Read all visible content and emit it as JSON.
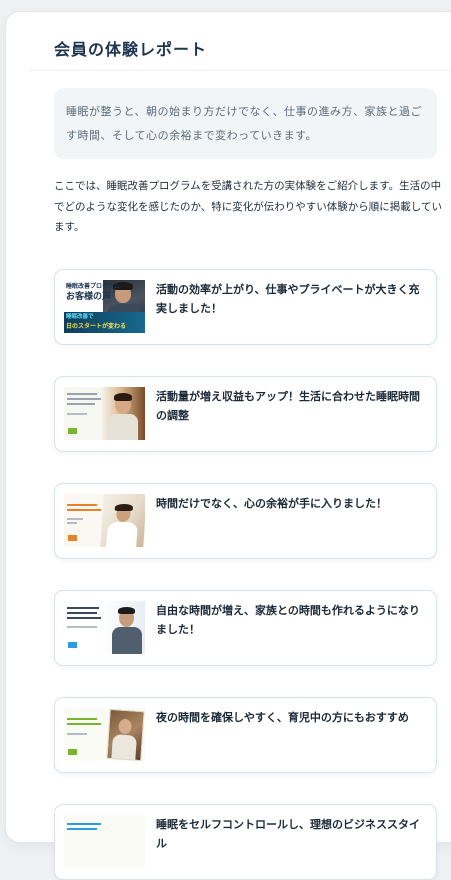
{
  "section": {
    "title": "会員の体験レポート",
    "lead": "睡眠が整うと、朝の始まり方だけでなく、仕事の進み方、家族と過ごす時間、そして心の余裕まで変わっていきます。",
    "intro": "ここでは、睡眠改善プログラムを受講された方の実体験をご紹介します。生活の中でどのような変化を感じたのか、特に変化が伝わりやすい体験から順に掲載しています。"
  },
  "reports": [
    {
      "title": "活動の効率が上がり、仕事やプライベートが大きく充実しました！",
      "thumb": {
        "line1": "睡眠改善プログラム",
        "line2": "お客様の声",
        "line3": "睡眠改善で",
        "line4": "日のスタートが変わる"
      }
    },
    {
      "title": "活動量が増え収益もアップ！生活に合わせた睡眠時間の調整",
      "thumb_tag": "#79b530"
    },
    {
      "title": "時間だけでなく、心の余裕が手に入りました！",
      "thumb_tag": "#e6822a"
    },
    {
      "title": "自由な時間が増え、家族との時間も作れるようになりました！",
      "thumb_tag": "#2d9be0"
    },
    {
      "title": "夜の時間を確保しやすく、育児中の方にもおすすめ",
      "thumb_tag": "#79b530"
    },
    {
      "title": "睡眠をセルフコントロールし、理想のビジネススタイル",
      "thumb_tag": "#2d9be0"
    }
  ]
}
